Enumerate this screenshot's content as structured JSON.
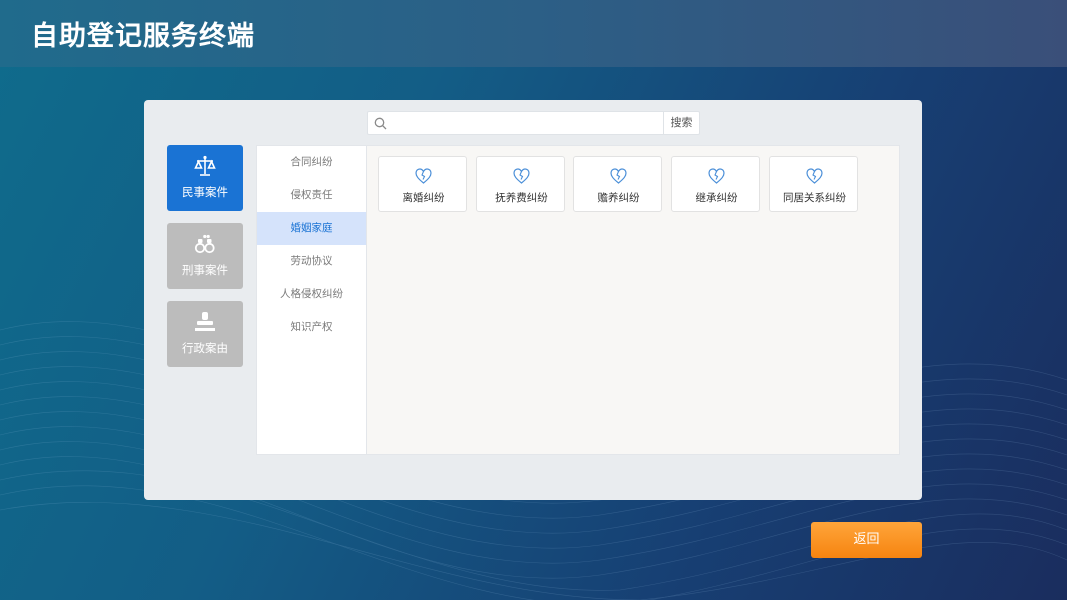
{
  "app": {
    "title": "自助登记服务终端"
  },
  "search": {
    "placeholder": "",
    "value": "",
    "button_label": "搜索"
  },
  "categories": [
    {
      "label": "民事案件",
      "icon": "scales-icon",
      "active": true
    },
    {
      "label": "刑事案件",
      "icon": "handcuffs-icon",
      "active": false
    },
    {
      "label": "行政案由",
      "icon": "stamp-icon",
      "active": false
    }
  ],
  "subcategories": [
    {
      "label": "合同纠纷",
      "active": false
    },
    {
      "label": "侵权责任",
      "active": false
    },
    {
      "label": "婚姻家庭",
      "active": true
    },
    {
      "label": "劳动协议",
      "active": false
    },
    {
      "label": "人格侵权纠纷",
      "active": false
    },
    {
      "label": "知识产权",
      "active": false
    }
  ],
  "cases": [
    {
      "label": "离婚纠纷",
      "icon": "broken-heart-icon"
    },
    {
      "label": "抚养费纠纷",
      "icon": "broken-heart-icon"
    },
    {
      "label": "赡养纠纷",
      "icon": "broken-heart-icon"
    },
    {
      "label": "继承纠纷",
      "icon": "broken-heart-icon"
    },
    {
      "label": "同居关系纠纷",
      "icon": "broken-heart-icon"
    }
  ],
  "footer": {
    "back_label": "返回"
  },
  "colors": {
    "accent": "#1a73d4",
    "inactive_category": "#bcbcbc",
    "active_subcategory_bg": "#d5e3fb",
    "back_button": "#f68410"
  }
}
